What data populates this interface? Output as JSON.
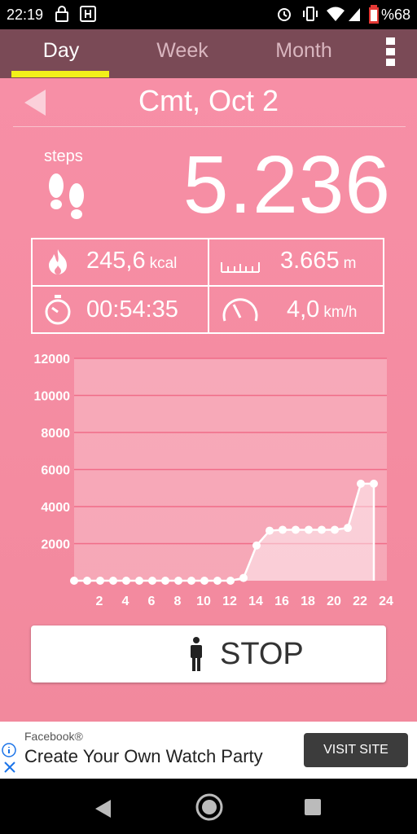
{
  "status_bar": {
    "time": "22:19",
    "battery_text": "%68",
    "icons": [
      "lock-icon",
      "vibrate-app-icon",
      "alarm-icon",
      "vibrate-icon",
      "wifi-icon",
      "signal-icon",
      "battery-icon"
    ]
  },
  "tabs": [
    {
      "label": "Day",
      "active": true
    },
    {
      "label": "Week",
      "active": false
    },
    {
      "label": "Month",
      "active": false
    }
  ],
  "header": {
    "date": "Cmt, Oct 2"
  },
  "steps": {
    "label": "steps",
    "value": "5.236"
  },
  "stats": {
    "calories": {
      "value": "245,6",
      "unit": "kcal"
    },
    "distance": {
      "value": "3.665",
      "unit": "m"
    },
    "duration": {
      "value": "00:54:35"
    },
    "speed": {
      "value": "4,0",
      "unit": "km/h"
    }
  },
  "chart_data": {
    "type": "area",
    "x": [
      0,
      1,
      2,
      3,
      4,
      5,
      6,
      7,
      8,
      9,
      10,
      11,
      12,
      13,
      14,
      15,
      16,
      17,
      18,
      19,
      20,
      21,
      22,
      23
    ],
    "values": [
      0,
      0,
      0,
      0,
      0,
      0,
      0,
      0,
      0,
      0,
      0,
      0,
      0,
      150,
      1900,
      2700,
      2750,
      2750,
      2750,
      2750,
      2750,
      2850,
      5236,
      5236
    ],
    "y_ticks": [
      2000,
      4000,
      6000,
      8000,
      10000,
      12000
    ],
    "x_ticks": [
      2,
      4,
      6,
      8,
      10,
      12,
      14,
      16,
      18,
      20,
      22,
      24
    ],
    "xlim": [
      0,
      24
    ],
    "ylim": [
      0,
      12000
    ],
    "grid": true
  },
  "stop_button": {
    "label": "STOP"
  },
  "ad": {
    "brand": "Facebook®",
    "headline": "Create Your Own Watch Party",
    "cta": "VISIT SITE"
  },
  "colors": {
    "tab_bar": "#7a4a56",
    "tab_indicator": "#f2f01a",
    "background": "#f78fa6"
  }
}
